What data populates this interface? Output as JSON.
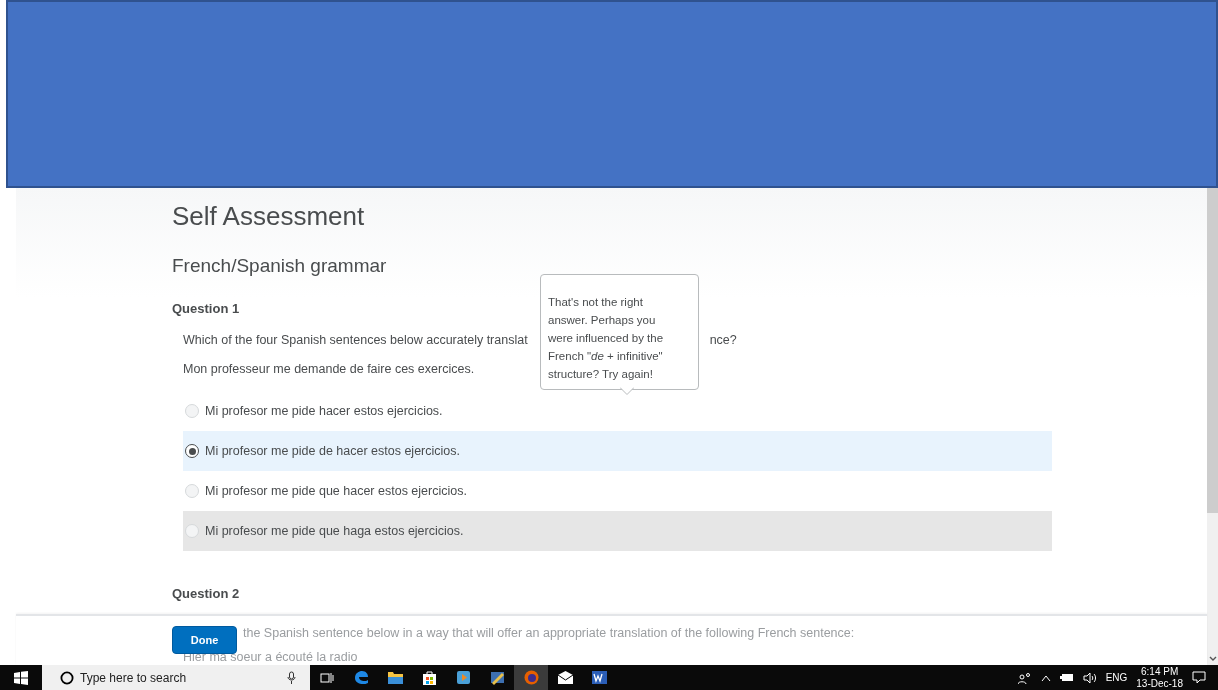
{
  "page": {
    "title": "Self Assessment",
    "section": "French/Spanish grammar"
  },
  "question_1": {
    "label": "Question 1",
    "prompt_start": "Which of the four Spanish sentences below accurately translat",
    "prompt_end": "nce?",
    "sentence": "Mon professeur me demande de faire ces exercices.",
    "options": [
      {
        "text": "Mi profesor me pide hacer estos ejercicios.",
        "selected": false,
        "hovered": false
      },
      {
        "text": "Mi profesor me pide de hacer estos ejercicios.",
        "selected": true,
        "hovered": false
      },
      {
        "text": "Mi profesor me pide que hacer estos ejercicios.",
        "selected": false,
        "hovered": false
      },
      {
        "text": "Mi profesor me pide que haga estos ejercicios.",
        "selected": false,
        "hovered": true
      }
    ]
  },
  "tooltip": {
    "text": "That's not the right answer. Perhaps you were influenced by the French \"*de* + infinitive\" structure? Try again!"
  },
  "question_2": {
    "label": "Question 2",
    "prompt_visible": "the Spanish sentence below in a way that will offer an appropriate translation of the following French sentence:",
    "sentence": "Hier ma soeur a écouté la radio"
  },
  "footer": {
    "button": "Done"
  },
  "taskbar": {
    "search_placeholder": "Type here to search",
    "language": "ENG",
    "time": "6:14 PM",
    "date": "13-Dec-18",
    "apps": [
      {
        "kind": "edge",
        "active": false
      },
      {
        "kind": "folder",
        "active": false
      },
      {
        "kind": "store",
        "active": false
      },
      {
        "kind": "player",
        "active": false
      },
      {
        "kind": "paint",
        "active": false
      },
      {
        "kind": "firefox",
        "active": true
      },
      {
        "kind": "mail",
        "active": false
      },
      {
        "kind": "word",
        "active": false
      }
    ]
  }
}
